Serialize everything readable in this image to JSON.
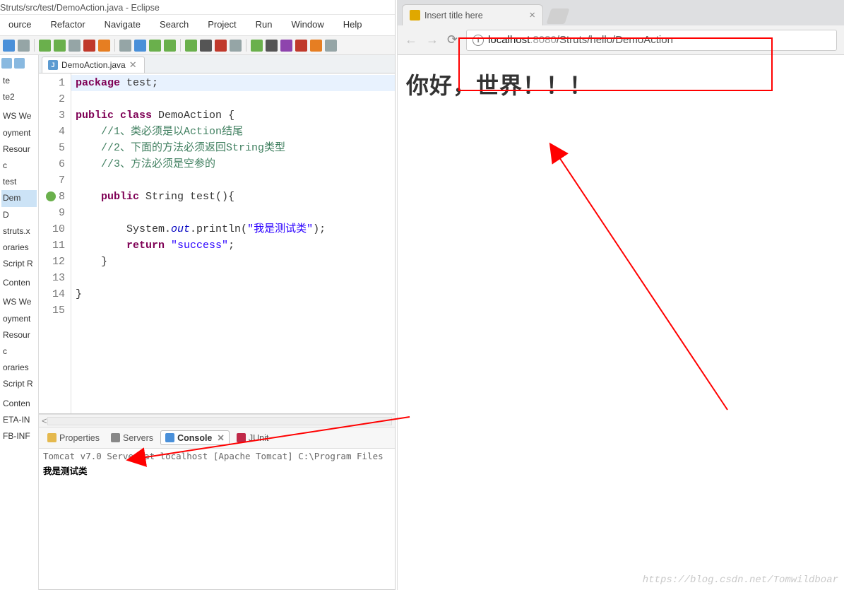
{
  "eclipse": {
    "title_fragment": "Struts/src/test/DemoAction.java - Eclipse",
    "menu": [
      "ource",
      "Refactor",
      "Navigate",
      "Search",
      "Project",
      "Run",
      "Window",
      "Help"
    ],
    "editor_tab": {
      "label": "DemoAction.java"
    },
    "code_lines": [
      {
        "n": 1,
        "hl": true,
        "html": "<span class='k'>package</span> test;"
      },
      {
        "n": 2,
        "html": ""
      },
      {
        "n": 3,
        "html": "<span class='k'>public</span> <span class='k'>class</span> DemoAction {"
      },
      {
        "n": 4,
        "html": "    <span class='c'>//1、类必须是以Action结尾</span>"
      },
      {
        "n": 5,
        "html": "    <span class='c'>//2、下面的方法必须返回String类型</span>"
      },
      {
        "n": 6,
        "html": "    <span class='c'>//3、方法必须是空参的</span>"
      },
      {
        "n": 7,
        "html": ""
      },
      {
        "n": 8,
        "mk": true,
        "html": "    <span class='k'>public</span> String test(){"
      },
      {
        "n": 9,
        "html": ""
      },
      {
        "n": 10,
        "html": "        System.<span class='it'>out</span>.println(<span class='s'>\"我是测试类\"</span>);"
      },
      {
        "n": 11,
        "html": "        <span class='k'>return</span> <span class='s'>\"success\"</span>;"
      },
      {
        "n": 12,
        "html": "    }"
      },
      {
        "n": 13,
        "html": ""
      },
      {
        "n": 14,
        "html": "}"
      },
      {
        "n": 15,
        "html": ""
      }
    ],
    "explorer_items": [
      "te",
      "te2",
      "",
      "WS We",
      "oyment",
      "Resour",
      "c",
      "test",
      "Dem",
      "  D",
      "struts.x",
      "oraries",
      "Script R",
      "",
      "Conten",
      "",
      "WS We",
      "oyment",
      "Resour",
      "c",
      "oraries",
      "Script R",
      "",
      "Conten",
      "ETA-IN",
      "FB-INF"
    ],
    "explorer_selected": "Dem",
    "bottom_tabs": {
      "properties": "Properties",
      "servers": "Servers",
      "console": "Console",
      "junit": "JUnit"
    },
    "console": {
      "title": "Tomcat v7.0 Server at localhost [Apache Tomcat] C:\\Program Files",
      "output": "我是测试类"
    }
  },
  "browser": {
    "tab_title": "Insert title here",
    "url_host": "localhost",
    "url_port": ":8080",
    "url_path": "/Struts/hello/DemoAction",
    "heading": "你好，世界！！！"
  },
  "watermark": "https://blog.csdn.net/Tomwildboar"
}
